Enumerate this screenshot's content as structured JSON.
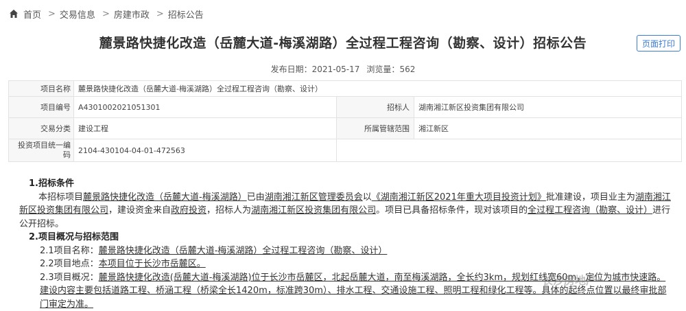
{
  "breadcrumb": {
    "home": "首页",
    "sep": ">",
    "items": [
      "交易信息",
      "房建市政",
      "招标公告"
    ]
  },
  "title": "麓景路快捷化改造（岳麓大道-梅溪湖路）全过程工程咨询（勘察、设计）招标公告",
  "print_button": "页面打印",
  "meta": {
    "publish_label": "发布日期：",
    "publish_date": "2021-05-17",
    "views_label": "浏览量：",
    "views": "562"
  },
  "info_table": {
    "project_name_label": "项目名称",
    "project_name": "麓景路快捷化改造（岳麓大道-梅溪湖路）全过程工程咨询（勘察、设计）",
    "project_no_label": "项目编号",
    "project_no": "A4301002021051301",
    "tenderer_label": "招标人",
    "tenderer": "湖南湘江新区投资集团有限公司",
    "category_label": "交易分类",
    "category": "建设工程",
    "region_label": "所属管辖范围",
    "region": "湘江新区",
    "code_label": "投资项目统一编码",
    "code": "2104-430104-04-01-472563"
  },
  "content": {
    "s1_title": "1.招标条件",
    "s1_a": "本招标项目",
    "s1_proj": "麓景路快捷化改造（岳麓大道-梅溪湖路）",
    "s1_b": "已由",
    "s1_approver": "湖南湘江新区管理委员会",
    "s1_c": "以",
    "s1_plan": "《湖南湘江新区2021年重大项目投资计划》",
    "s1_d": "批准建设，项目业主为",
    "s1_owner": "湖南湘江新区投资集团有限公司",
    "s1_e": "，建设资金来自",
    "s1_fund": "政府投资",
    "s1_f": "，招标人为",
    "s1_tenderer": "湖南湘江新区投资集团有限公司",
    "s1_g": "。项目已具备招标条件，现对该项目的",
    "s1_scope": "全过程工程咨询（勘察、设计）",
    "s1_h": "进行公开招标。",
    "s2_title": "2.项目概况与招标范围",
    "s21_label": "2.1项目名称：",
    "s21_value": "麓景路快捷化改造（岳麓大道-梅溪湖路）全过程工程咨询（勘察、设计）",
    "s22_label": "2.2项目地点：",
    "s22_value": "本项目位于长沙市岳麓区。",
    "s23_label": "2.3项目概况：",
    "s23_value": "麓景路快捷化改造(岳麓大道-梅溪湖路)位于长沙市岳麓区，北起岳麓大道，南至梅溪湖路，全长约3km，规划红线宽60m，定位为城市快速路。建设内容主要包括道路工程、桥涵工程（桥梁全长1420m，标准跨30m）、排水工程、交通设施工程、照明工程和绿化工程等。具体的起终点位置以最终审批部门审定为准。"
  },
  "watermark": "长沙房地产"
}
